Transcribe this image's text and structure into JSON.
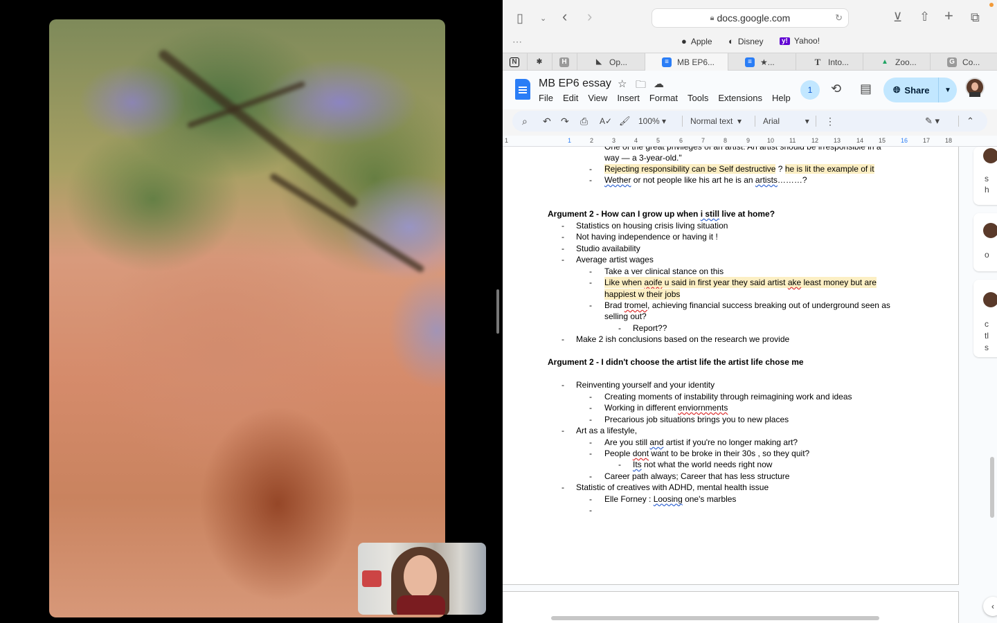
{
  "safari": {
    "url": "docs.google.com",
    "favorites": [
      {
        "icon": "apple-icon",
        "label": "Apple"
      },
      {
        "icon": "disney-icon",
        "label": "Disney"
      },
      {
        "icon": "yahoo-icon",
        "label": "Yahoo!"
      }
    ],
    "tabs": [
      {
        "label": "",
        "icon": "N",
        "color": "#000000"
      },
      {
        "label": "",
        "icon": "✱",
        "color": "#000000"
      },
      {
        "label": "",
        "icon": "H",
        "color": "#9a9a9a"
      },
      {
        "label": "Op...",
        "icon": "◣",
        "color": "#000000"
      },
      {
        "label": "MB EP6...",
        "icon": "≡",
        "color": "#2a7df6"
      },
      {
        "label": "★...",
        "icon": "≡",
        "color": "#2a7df6"
      },
      {
        "label": "Into...",
        "icon": "T",
        "color": "#000000"
      },
      {
        "label": "Zoo...",
        "icon": "▲",
        "color": "#1fa463"
      },
      {
        "label": "Co...",
        "icon": "G",
        "color": "#9a9a9a"
      }
    ]
  },
  "docs": {
    "title": "MB EP6 essay",
    "menu": [
      "File",
      "Edit",
      "View",
      "Insert",
      "Format",
      "Tools",
      "Extensions",
      "Help"
    ],
    "collaborators": "1",
    "share_label": "Share",
    "toolbar": {
      "zoom": "100%",
      "style": "Normal text",
      "font": "Arial"
    },
    "ruler": [
      "1",
      "1",
      "2",
      "3",
      "4",
      "5",
      "6",
      "7",
      "8",
      "9",
      "10",
      "11",
      "12",
      "13",
      "14",
      "15",
      "16",
      "17",
      "18"
    ]
  },
  "content": {
    "l0": "One of the great privileges of an artist: An artist should be irresponsible in a",
    "l1": "way — a 3-year-old.\"",
    "l2a": "Rejecting responsibility can be Self destructive",
    "l2b": " ? ",
    "l2c": "he is lit the example of it",
    "l3a": "Wether",
    "l3b": " or not people like his art he is an ",
    "l3c": "artists",
    "l3d": "………?",
    "h1a": "Argument  2 -  How can I grow up when ",
    "h1b": "i still",
    "h1c": " live at home?",
    "a1": "Statistics on housing crisis living situation",
    "a2": "Not having independence or having it !",
    "a3": "Studio availability",
    "a4": "Average artist wages",
    "a4a": "Take a ver clinical stance on this",
    "a4b1a": "Like when ",
    "a4b1b": "aoife",
    "a4b1c": " u said in first year they said artist ",
    "a4b1d": "ake",
    "a4b1e": " least money but are",
    "a4b2": "happiest w their jobs",
    "a4c1a": "Brad ",
    "a4c1b": "tromel",
    "a4c1c": ", achieving financial success breaking out of underground seen as",
    "a4c2": "selling out?",
    "a4c3": "Report??",
    "a5": "Make 2 ish conclusions based on the research we provide",
    "h2": "Argument 2 - I didn't choose the artist life the artist life chose me",
    "b1": "Reinventing yourself and your identity",
    "b1a": "Creating moments of instability through reimagining work and ideas",
    "b1b1": "Working in different ",
    "b1b2": "enviornments",
    "b1c": "Precarious job situations brings you to new places",
    "b2": "Art as a lifestyle,",
    "b2a1": "Are you still ",
    "b2a2": "and",
    "b2a3": " artist if you're no longer making art?",
    "b2b1": "People ",
    "b2b2": "dont",
    "b2b3": " want to be broke in their 30s , so they quit?",
    "b2b4a": "Its",
    "b2b4b": " not what the world needs right now",
    "b2c": "Career path always; Career that has less structure",
    "b3": "Statistic of creatives with ADHD, mental health issue",
    "b3a1": "Elle Forney : ",
    "b3a2": "Loosing",
    "b3a3": " one's marbles",
    "dash": "-"
  },
  "comments": [
    "s",
    "h",
    "o",
    "c",
    "tl",
    "s"
  ]
}
